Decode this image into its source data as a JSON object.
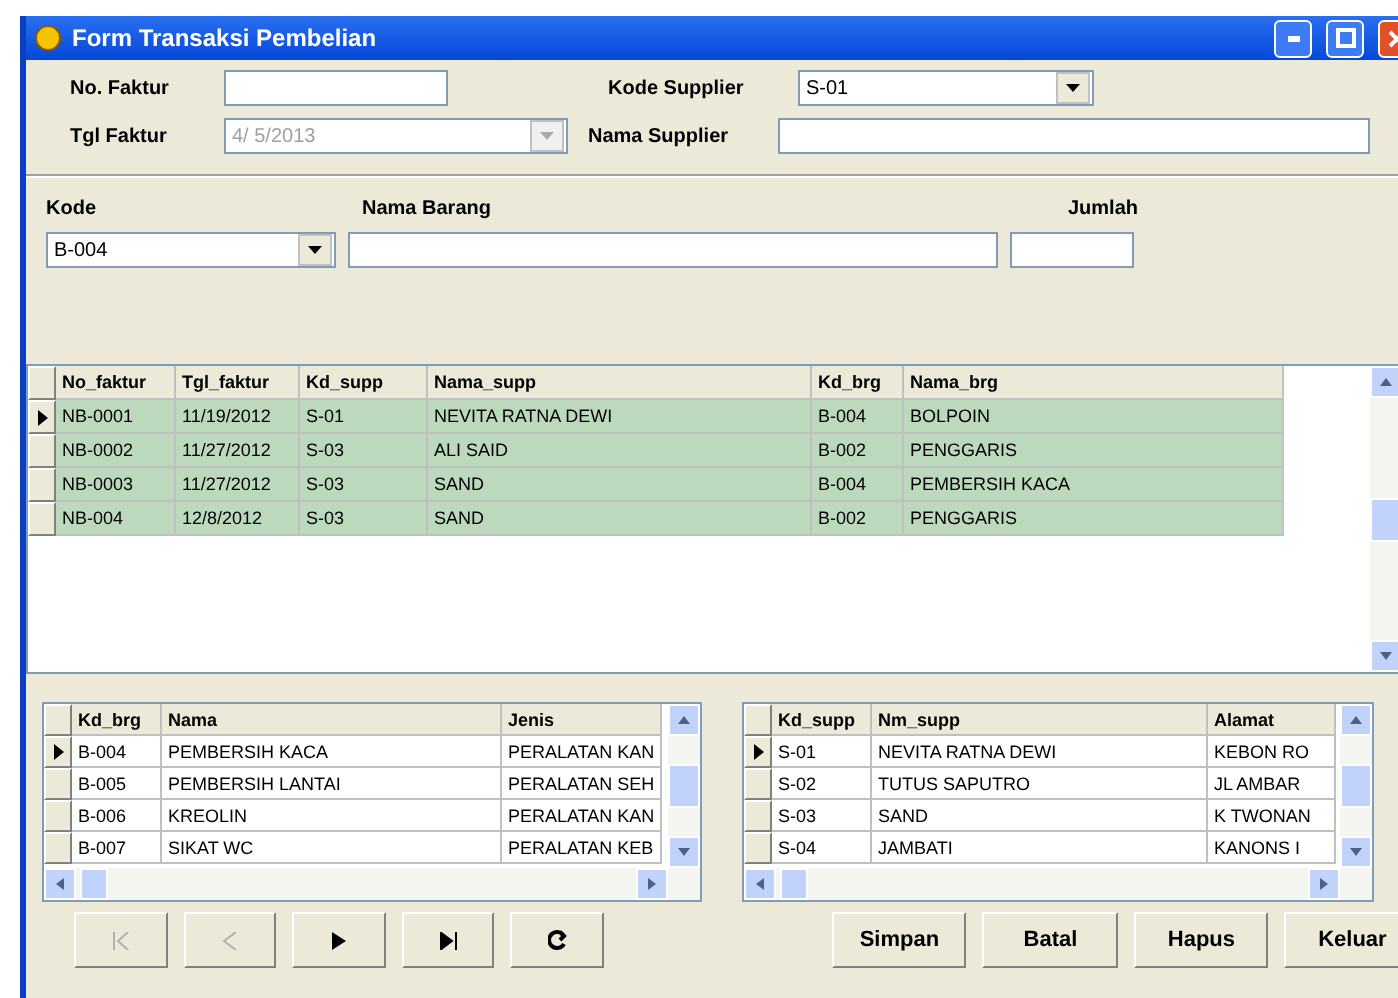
{
  "window": {
    "title": "Form Transaksi Pembelian"
  },
  "header": {
    "no_faktur": {
      "label": "No. Faktur"
    },
    "tgl_faktur": {
      "label": "Tgl Faktur",
      "value": "4/ 5/2013",
      "disabled": true
    },
    "kode_supplier": {
      "label": "Kode Supplier",
      "value": "S-01"
    },
    "nama_supplier": {
      "label": "Nama Supplier"
    }
  },
  "item": {
    "kode": {
      "label": "Kode",
      "value": "B-004"
    },
    "nama_barang": {
      "label": "Nama Barang"
    },
    "jumlah": {
      "label": "Jumlah"
    }
  },
  "main_grid": {
    "columns": [
      "No_faktur",
      "Tgl_faktur",
      "Kd_supp",
      "Nama_supp",
      "Kd_brg",
      "Nama_brg"
    ],
    "rows": [
      {
        "cells": [
          "NB-0001",
          "11/19/2012",
          "S-01",
          "NEVITA RATNA DEWI",
          "B-004",
          "BOLPOIN"
        ],
        "selected": true
      },
      {
        "cells": [
          "NB-0002",
          "11/27/2012",
          "S-03",
          "ALI SAID",
          "B-002",
          "PENGGARIS"
        ],
        "selected": false
      },
      {
        "cells": [
          "NB-0003",
          "11/27/2012",
          "S-03",
          "SAND",
          "B-004",
          "PEMBERSIH KACA"
        ],
        "selected": false
      },
      {
        "cells": [
          "NB-004",
          "12/8/2012",
          "S-03",
          "SAND",
          "B-002",
          "PENGGARIS"
        ],
        "selected": false
      }
    ]
  },
  "barang_grid": {
    "columns": [
      "Kd_brg",
      "Nama",
      "Jenis"
    ],
    "rows": [
      {
        "cells": [
          "B-004",
          "PEMBERSIH KACA",
          "PERALATAN KAN"
        ],
        "selected": true
      },
      {
        "cells": [
          "B-005",
          "PEMBERSIH LANTAI",
          "PERALATAN SEH"
        ],
        "selected": false
      },
      {
        "cells": [
          "B-006",
          "KREOLIN",
          "PERALATAN KAN"
        ],
        "selected": false
      },
      {
        "cells": [
          "B-007",
          "SIKAT WC",
          "PERALATAN KEB"
        ],
        "selected": false
      }
    ]
  },
  "supplier_grid": {
    "columns": [
      "Kd_supp",
      "Nm_supp",
      "Alamat"
    ],
    "rows": [
      {
        "cells": [
          "S-01",
          "NEVITA RATNA DEWI",
          "KEBON RO"
        ],
        "selected": true
      },
      {
        "cells": [
          "S-02",
          "TUTUS SAPUTRO",
          "JL AMBAR"
        ],
        "selected": false
      },
      {
        "cells": [
          "S-03",
          "SAND",
          "K TWONAN"
        ],
        "selected": false
      },
      {
        "cells": [
          "S-04",
          "JAMBATI",
          "KANONS I"
        ],
        "selected": false
      }
    ]
  },
  "navigator": [
    {
      "kind": "first",
      "disabled": true
    },
    {
      "kind": "prev",
      "disabled": true
    },
    {
      "kind": "next",
      "disabled": false
    },
    {
      "kind": "last",
      "disabled": false
    },
    {
      "kind": "refresh",
      "disabled": false
    }
  ],
  "buttons": [
    "Simpan",
    "Batal",
    "Hapus",
    "Keluar"
  ]
}
